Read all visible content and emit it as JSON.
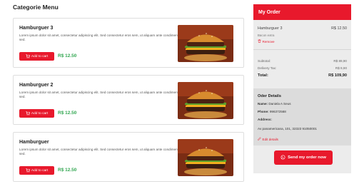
{
  "page": {
    "title": "Categorie Menu"
  },
  "menu": {
    "items": [
      {
        "name": "Hamburguer 3",
        "description": "Lorem ipsum dolor sit amet, consectetur adipiscing elit. Sed consectetur eros sem, ut aliquam ante condimentum sed.",
        "button_label": "Add to cart",
        "price": "R$ 12.50"
      },
      {
        "name": "Hamburguer 2",
        "description": "Lorem ipsum dolor sit amet, consectetur adipiscing elit. Sed consectetur eros sem, ut aliquam ante condimentum sed.",
        "button_label": "Add to cart",
        "price": "R$ 12.50"
      },
      {
        "name": "Hamburguer",
        "description": "Lorem ipsum dolor sit amet, consectetur adipiscing elit. Sed consectetur eros sem, ut aliquam ante condimentum sed.",
        "button_label": "Add to cart",
        "price": "R$ 12.50"
      }
    ]
  },
  "order": {
    "title": "My Order",
    "item": {
      "name": "Hamburguer 3",
      "price": "R$ 12.50",
      "note": "Bacon extra",
      "remove_label": "Remove"
    },
    "summary": {
      "subtotal_label": "Subtotal:",
      "subtotal_value": "R$ 89,90",
      "delivery_label": "Delivery Tax:",
      "delivery_value": "R$ 9,90",
      "total_label": "Total:",
      "total_value": "R$ 109,90"
    },
    "details": {
      "title": "Oder Details",
      "name_label": "Name:",
      "name_value": "Daniela A Seus",
      "phone_label": "Phone:",
      "phone_value": "996372568",
      "address_label": "Address:",
      "address_value": "Av panamericana, 101, 32323 91050001",
      "edit_label": "Edit details"
    },
    "send_label": "Send my order now"
  },
  "colors": {
    "accent": "#e8192c",
    "price": "#34a853",
    "sidebar_bg": "#ececec"
  }
}
